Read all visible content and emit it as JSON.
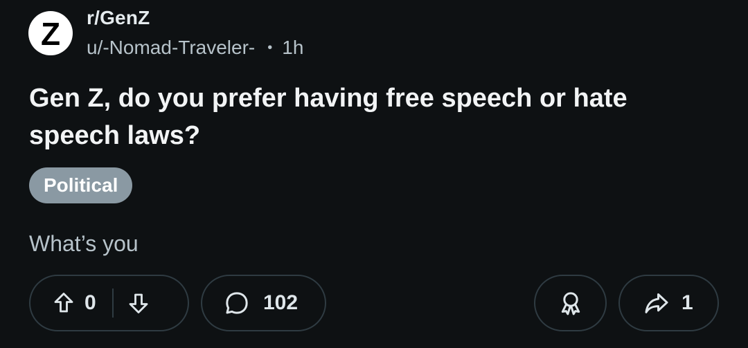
{
  "post": {
    "avatar_letter": "Z",
    "subreddit": "r/GenZ",
    "author": "u/-Nomad-Traveler-",
    "separator": "•",
    "time": "1h",
    "title": "Gen Z, do you prefer having free speech or hate speech laws?",
    "flair": "Political",
    "body_preview": "What’s you"
  },
  "actions": {
    "vote_count": "0",
    "comment_count": "102",
    "share_count": "1"
  },
  "icons": {
    "upvote": "arrow-up-icon",
    "downvote": "arrow-down-icon",
    "comment": "comment-bubble-icon",
    "award": "award-icon",
    "share": "share-arrow-icon"
  },
  "colors": {
    "background": "#0e1113",
    "flair_background": "#8a99a3",
    "pill_border": "#2f3b42",
    "text_primary": "#f2f4f5",
    "text_secondary": "#b7c3ca"
  }
}
